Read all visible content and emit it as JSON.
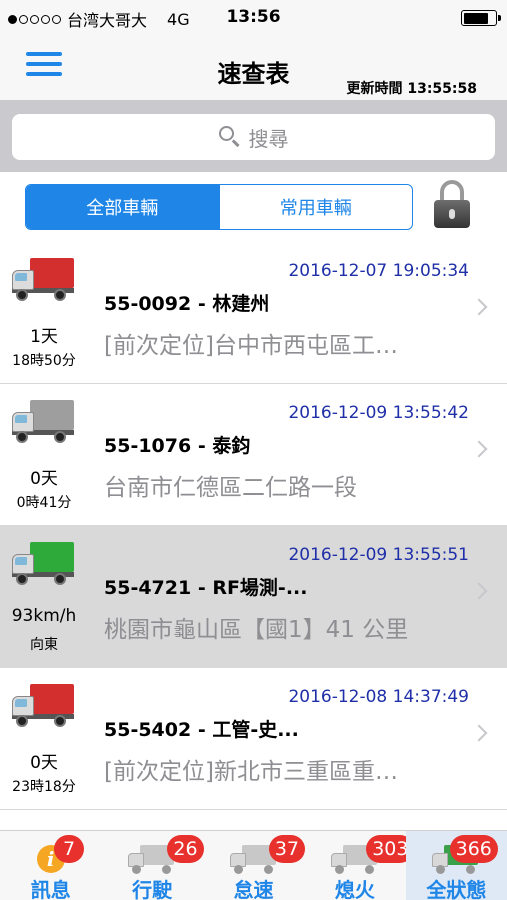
{
  "status_bar": {
    "carrier": "台湾大哥大",
    "network": "4G",
    "time": "13:56",
    "signal_dots": 5,
    "signal_filled": 1
  },
  "nav": {
    "title": "速查表",
    "update_label": "更新時間",
    "update_time": "13:55:58"
  },
  "search": {
    "placeholder": "搜尋"
  },
  "segments": {
    "all": "全部車輛",
    "favorite": "常用車輛"
  },
  "rows": [
    {
      "timestamp": "2016-12-07 19:05:34",
      "title": "55-0092 - 林建州",
      "address": "[前次定位]台中市西屯區工…",
      "duration": "1天",
      "duration2": "18時50分",
      "truck_color": "#d32f2f"
    },
    {
      "timestamp": "2016-12-09 13:55:42",
      "title": "55-1076 - 泰鈞",
      "address": "台南市仁德區二仁路一段",
      "duration": "0天",
      "duration2": "0時41分",
      "truck_color": "#9e9e9e"
    },
    {
      "timestamp": "2016-12-09 13:55:51",
      "title": "55-4721 - RF場測-...",
      "address": "桃園市龜山區【國1】41 公里",
      "duration": "93km/h",
      "duration2": "向東",
      "truck_color": "#2eaa3a"
    },
    {
      "timestamp": "2016-12-08 14:37:49",
      "title": "55-5402 - 工管-史...",
      "address": "[前次定位]新北市三重區重…",
      "duration": "0天",
      "duration2": "23時18分",
      "truck_color": "#d32f2f"
    }
  ],
  "tabs": [
    {
      "label": "訊息",
      "badge": "7"
    },
    {
      "label": "行駛",
      "badge": "26"
    },
    {
      "label": "怠速",
      "badge": "37"
    },
    {
      "label": "熄火",
      "badge": "303"
    },
    {
      "label": "全狀態",
      "badge": "366"
    }
  ],
  "colors": {
    "accent": "#1f86e8",
    "badge": "#e8312c",
    "timestamp": "#1f2fa8"
  }
}
